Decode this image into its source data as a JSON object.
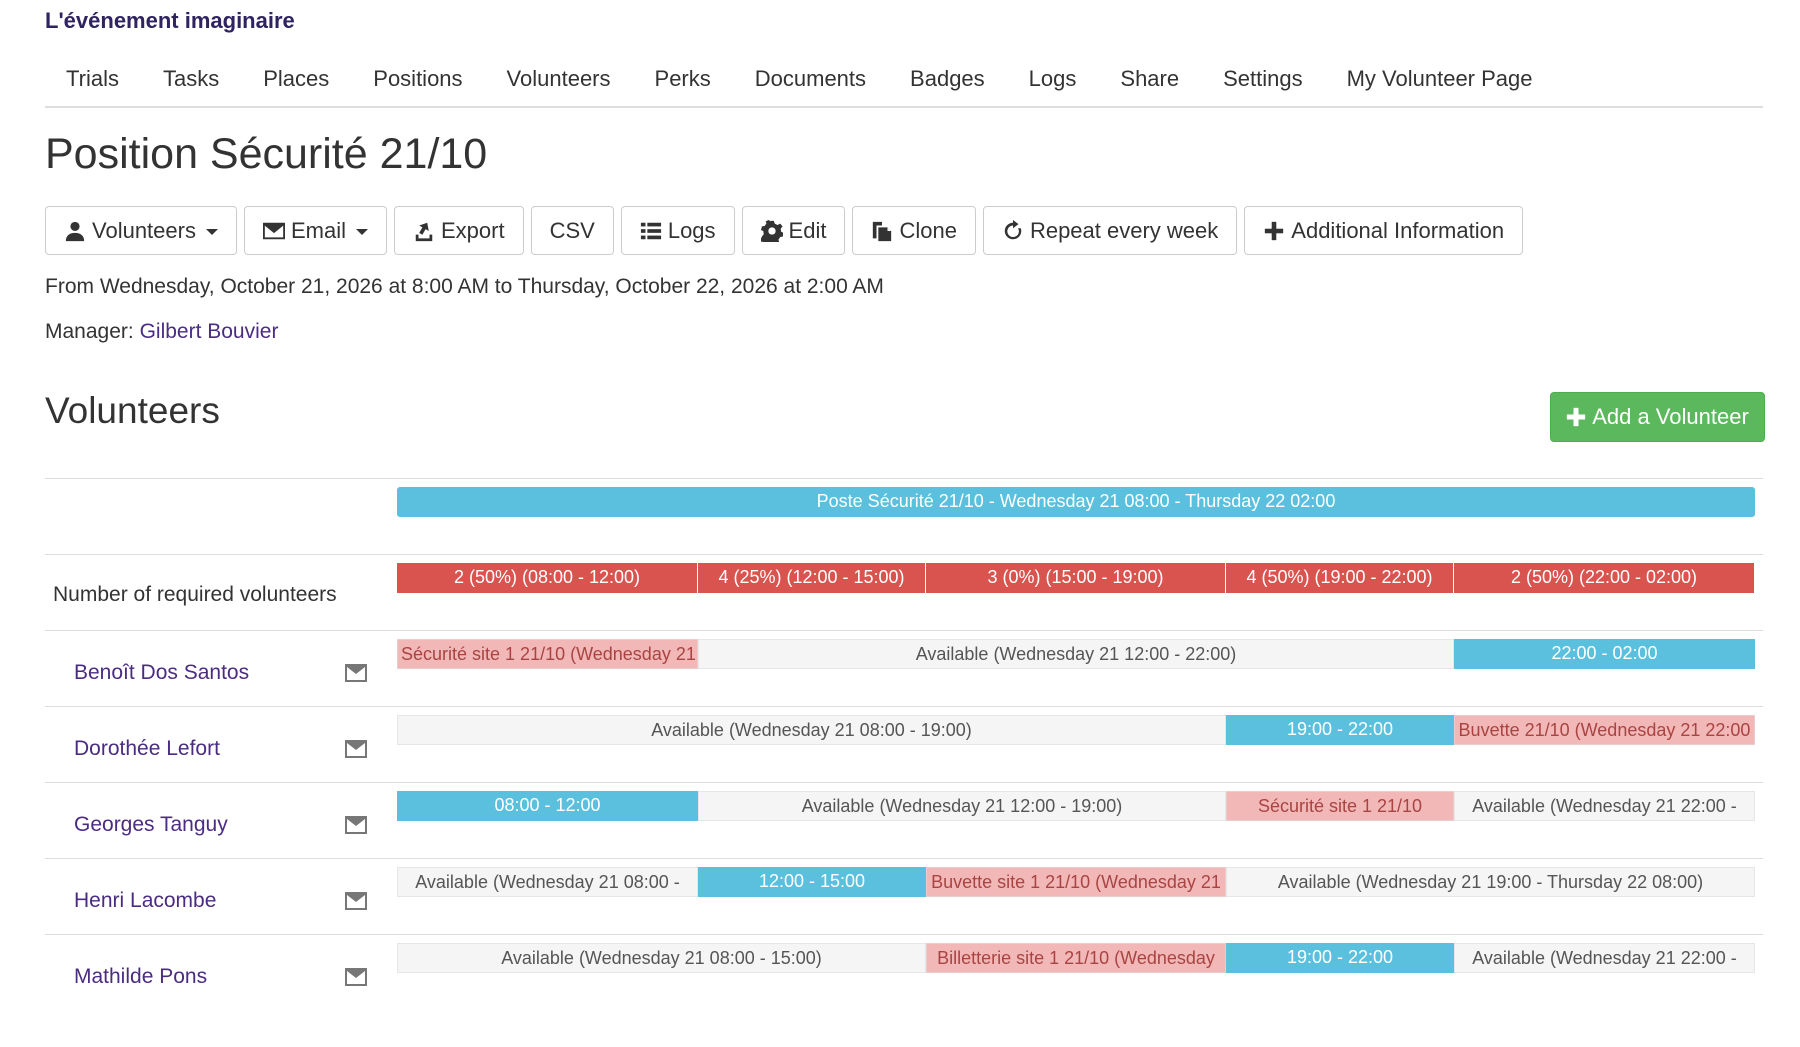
{
  "brand": "L'événement imaginaire",
  "nav": [
    "Trials",
    "Tasks",
    "Places",
    "Positions",
    "Volunteers",
    "Perks",
    "Documents",
    "Badges",
    "Logs",
    "Share",
    "Settings",
    "My Volunteer Page"
  ],
  "page_title": "Position Sécurité 21/10",
  "toolbar": {
    "volunteers": "Volunteers",
    "email": "Email",
    "export": "Export",
    "csv": "CSV",
    "logs": "Logs",
    "edit": "Edit",
    "clone": "Clone",
    "repeat": "Repeat every week",
    "additional": "Additional Information"
  },
  "date_range": "From Wednesday, October 21, 2026 at 8:00 AM to Thursday, October 22, 2026 at 2:00 AM",
  "manager": {
    "label": "Manager:",
    "name": "Gilbert Bouvier"
  },
  "volunteers_section": {
    "title": "Volunteers",
    "add_button": "Add a Volunteer"
  },
  "position_bar": "Poste Sécurité 21/10 - Wednesday 21 08:00 - Thursday 22 02:00",
  "required_label": "Number of required volunteers",
  "required": [
    "2 (50%) (08:00 - 12:00)",
    "4 (25%) (12:00 - 15:00)",
    "3 (0%) (15:00 - 19:00)",
    "4 (50%) (19:00 - 22:00)",
    "2 (50%) (22:00 - 02:00)"
  ],
  "volunteers": [
    {
      "name": "Benoît Dos Santos",
      "segments": [
        "Sécurité site 1 21/10 (Wednesday 21",
        "Available (Wednesday 21 12:00 - 22:00)",
        "22:00 - 02:00"
      ]
    },
    {
      "name": "Dorothée Lefort",
      "segments": [
        "Available (Wednesday 21 08:00 - 19:00)",
        "19:00 - 22:00",
        "Buvette 21/10 (Wednesday 21 22:00"
      ]
    },
    {
      "name": "Georges Tanguy",
      "segments": [
        "08:00 - 12:00",
        "Available (Wednesday 21 12:00 - 19:00)",
        "Sécurité site 1 21/10",
        "Available (Wednesday 21 22:00 -"
      ]
    },
    {
      "name": "Henri Lacombe",
      "segments": [
        "Available (Wednesday 21 08:00 -",
        "12:00 - 15:00",
        "Buvette site 1 21/10 (Wednesday 21",
        "Available (Wednesday 21 19:00 - Thursday 22 08:00)"
      ]
    },
    {
      "name": "Mathilde Pons",
      "segments": [
        "Available (Wednesday 21 08:00 - 15:00)",
        "Billetterie site 1 21/10 (Wednesday",
        "19:00 - 22:00",
        "Available (Wednesday 21 22:00 -"
      ]
    }
  ],
  "colors": {
    "brand": "#2f2360",
    "link": "#4b2c83",
    "position_bar": "#5bc0de",
    "required": "#d9534f",
    "busy": "#f2b8b8",
    "available": "#f5f5f5",
    "add_button": "#5cb85c"
  }
}
